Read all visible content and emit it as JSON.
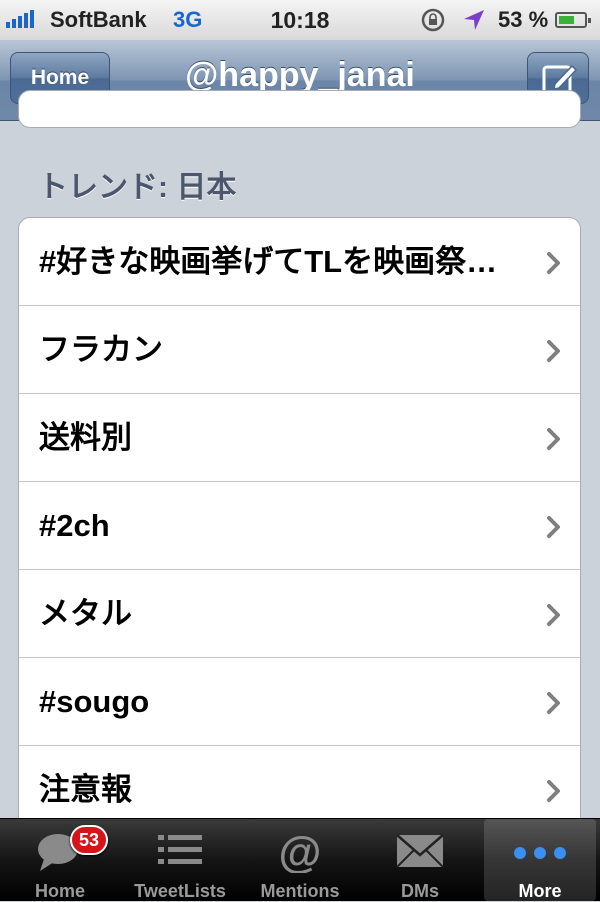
{
  "status_bar": {
    "carrier": "SoftBank",
    "network": "3G",
    "time": "10:18",
    "battery_percent": "53 %",
    "battery_level": 0.53
  },
  "nav": {
    "back_label": "Home",
    "title": "@happy_janai"
  },
  "trends": {
    "header": "トレンド: 日本",
    "items": [
      {
        "label": "#好きな映画挙げてTLを映画祭…"
      },
      {
        "label": "フラカン"
      },
      {
        "label": "送料別"
      },
      {
        "label": "#2ch"
      },
      {
        "label": "メタル"
      },
      {
        "label": "#sougo"
      },
      {
        "label": "注意報"
      }
    ]
  },
  "tabbar": {
    "tabs": [
      {
        "label": "Home",
        "icon": "speech-bubble-icon",
        "badge": "53"
      },
      {
        "label": "TweetLists",
        "icon": "list-icon"
      },
      {
        "label": "Mentions",
        "icon": "at-icon"
      },
      {
        "label": "DMs",
        "icon": "envelope-icon"
      },
      {
        "label": "More",
        "icon": "more-dots-icon",
        "selected": true
      }
    ]
  }
}
